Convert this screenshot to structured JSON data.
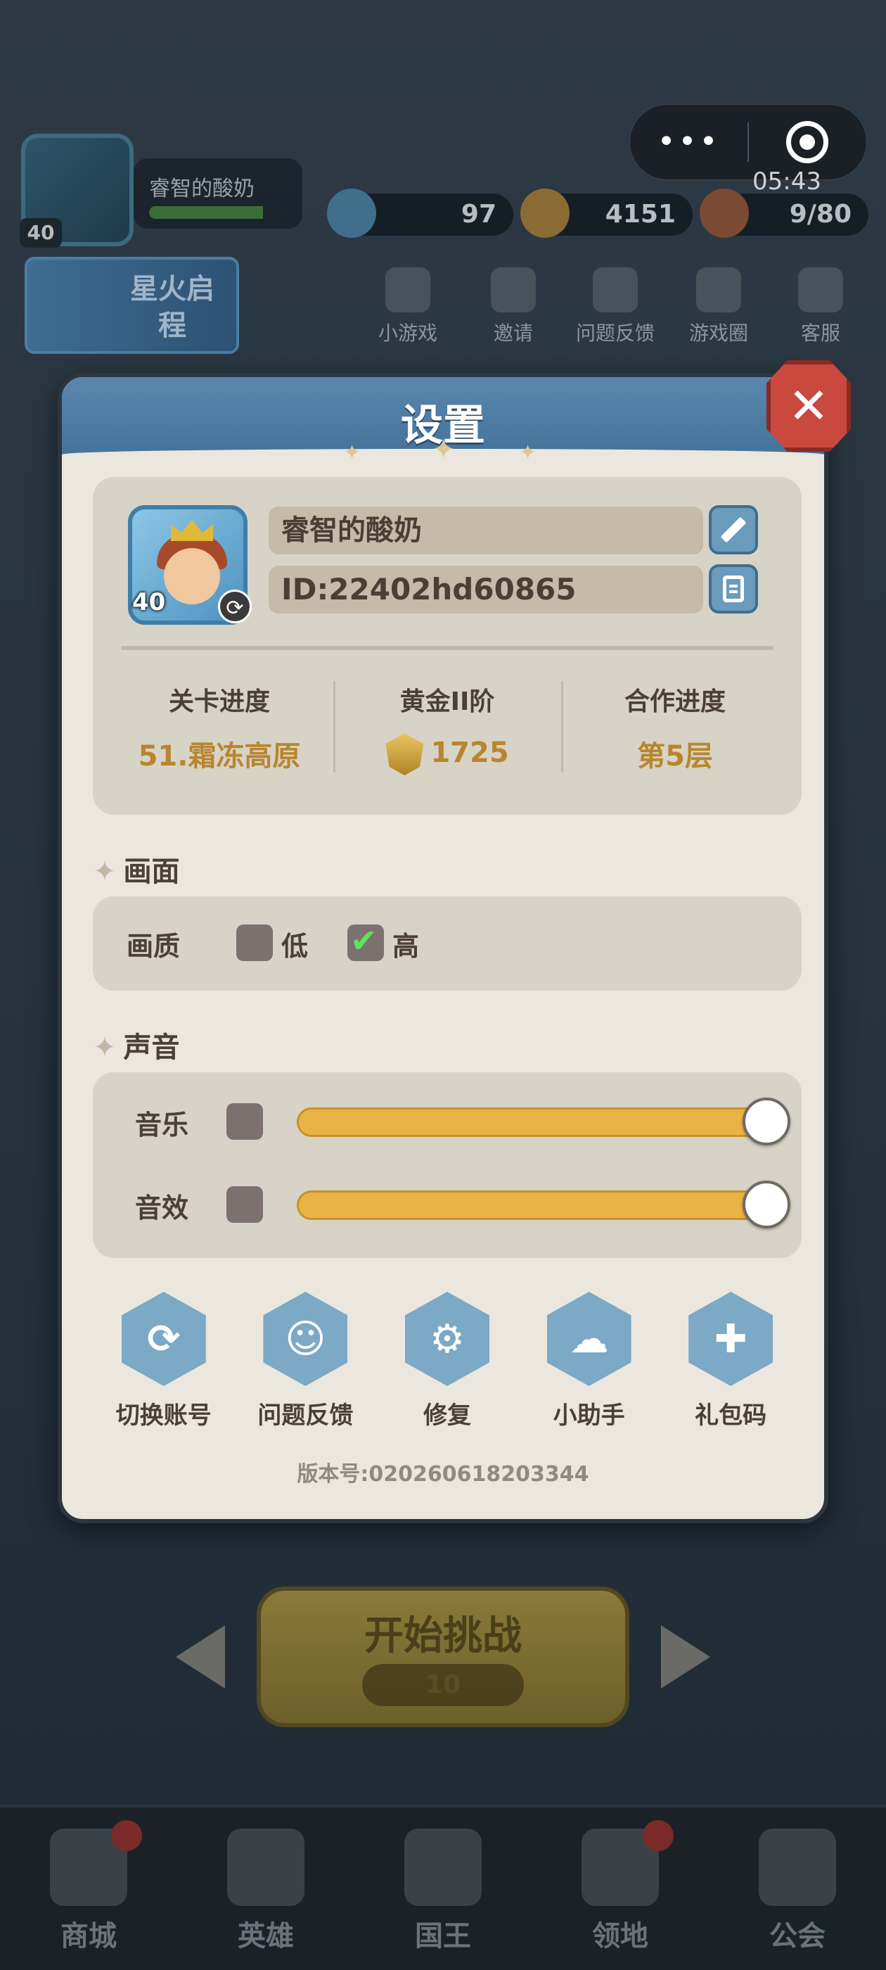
{
  "capsule": {
    "more_icon": "more-dots-icon",
    "close_icon": "target-icon"
  },
  "hud": {
    "player_name": "睿智的酸奶",
    "player_level": "40",
    "xp_fraction": 0.85,
    "gems": "97",
    "coins": "4151",
    "stamina": "9/80",
    "time": "05:43",
    "banner_title": "星火启程",
    "menu": [
      "小游戏",
      "邀请",
      "问题反馈",
      "游戏圈",
      "客服"
    ]
  },
  "stage": {
    "start_label": "开始挑战",
    "cost": "10"
  },
  "bottom_nav": [
    "商城",
    "英雄",
    "国王",
    "领地",
    "公会"
  ],
  "modal": {
    "title": "设置",
    "profile": {
      "name": "睿智的酸奶",
      "id": "ID:22402hd60865",
      "level": "40",
      "stats": [
        {
          "label": "关卡进度",
          "value": "51.霜冻高原"
        },
        {
          "label": "黄金II阶",
          "value": "1725"
        },
        {
          "label": "合作进度",
          "value": "第5层"
        }
      ]
    },
    "graphics": {
      "section": "画面",
      "quality_label": "画质",
      "low": "低",
      "high": "高",
      "selected": "高"
    },
    "sound": {
      "section": "声音",
      "music_label": "音乐",
      "sfx_label": "音效",
      "music_level": 1.0,
      "sfx_level": 1.0
    },
    "actions": [
      {
        "label": "切换账号",
        "icon": "refresh-icon"
      },
      {
        "label": "问题反馈",
        "icon": "headset-icon"
      },
      {
        "label": "修复",
        "icon": "gear-wrench-icon"
      },
      {
        "label": "小助手",
        "icon": "wechat-icon"
      },
      {
        "label": "礼包码",
        "icon": "gift-icon"
      }
    ],
    "version": "版本号:020260618203344"
  },
  "colors": {
    "accent_gold": "#b8862e",
    "header_blue": "#5b87ad",
    "close_red": "#c9493f",
    "slider_orange": "#e9b346"
  }
}
